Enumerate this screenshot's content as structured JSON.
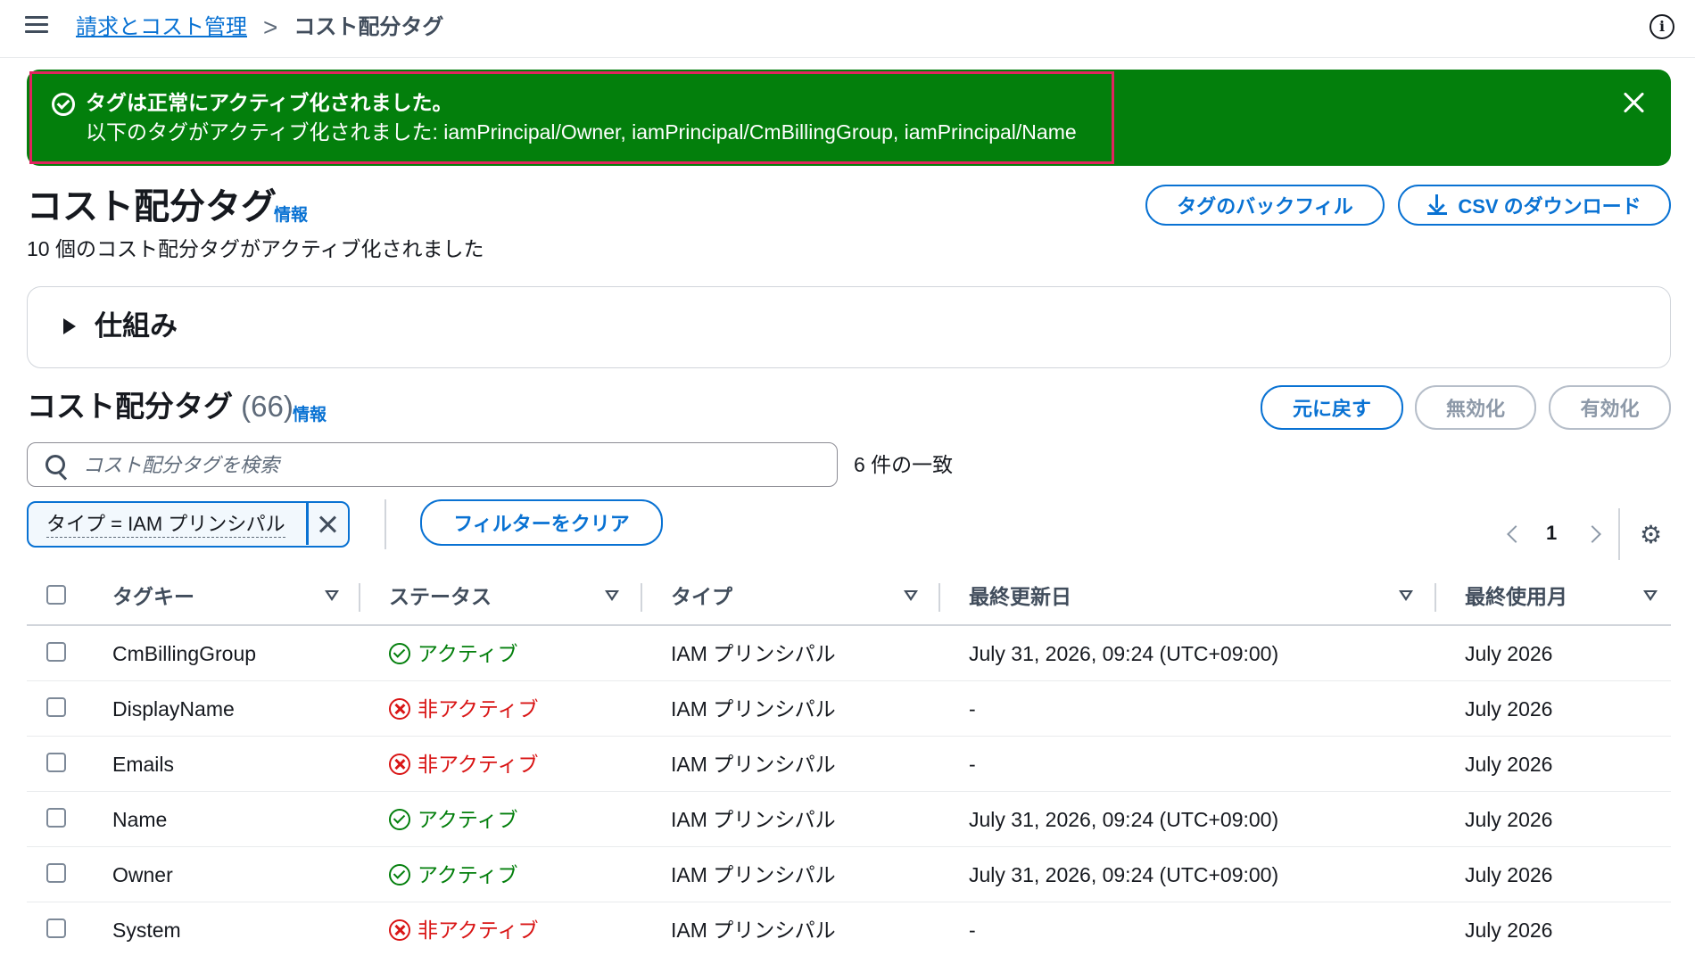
{
  "breadcrumb": {
    "parent": "請求とコスト管理",
    "separator": ">",
    "current": "コスト配分タグ"
  },
  "topbar": {
    "info_icon": "i"
  },
  "flash": {
    "type": "success",
    "title": "タグは正常にアクティブ化されました。",
    "message": "以下のタグがアクティブ化されました: iamPrincipal/Owner, iamPrincipal/CmBillingGroup, iamPrincipal/Name",
    "color": "#037f0c",
    "highlight_color": "#e0245e"
  },
  "header": {
    "title": "コスト配分タグ",
    "info_label": "情報",
    "subtitle": "10 個のコスト配分タグがアクティブ化されました",
    "backfill_label": "タグのバックフィル",
    "download_label": "CSV のダウンロード"
  },
  "how_it_works": {
    "label": "仕組み",
    "expanded": false
  },
  "table_section": {
    "title": "コスト配分タグ",
    "count": "(66)",
    "info_label": "情報",
    "revert_label": "元に戻す",
    "deactivate_label": "無効化",
    "activate_label": "有効化",
    "search_placeholder": "コスト配分タグを検索",
    "match_count": "6 件の一致",
    "filter_token": "タイプ = IAM プリンシパル",
    "clear_filter_label": "フィルターをクリア",
    "page": "1"
  },
  "columns": [
    "タグキー",
    "ステータス",
    "タイプ",
    "最終更新日",
    "最終使用月"
  ],
  "rows": [
    {
      "key": "CmBillingGroup",
      "status": "アクティブ",
      "status_kind": "active",
      "type": "IAM プリンシパル",
      "updated": "July 31, 2026, 09:24 (UTC+09:00)",
      "last_used": "July 2026"
    },
    {
      "key": "DisplayName",
      "status": "非アクティブ",
      "status_kind": "inactive",
      "type": "IAM プリンシパル",
      "updated": "-",
      "last_used": "July 2026"
    },
    {
      "key": "Emails",
      "status": "非アクティブ",
      "status_kind": "inactive",
      "type": "IAM プリンシパル",
      "updated": "-",
      "last_used": "July 2026"
    },
    {
      "key": "Name",
      "status": "アクティブ",
      "status_kind": "active",
      "type": "IAM プリンシパル",
      "updated": "July 31, 2026, 09:24 (UTC+09:00)",
      "last_used": "July 2026"
    },
    {
      "key": "Owner",
      "status": "アクティブ",
      "status_kind": "active",
      "type": "IAM プリンシパル",
      "updated": "July 31, 2026, 09:24 (UTC+09:00)",
      "last_used": "July 2026"
    },
    {
      "key": "System",
      "status": "非アクティブ",
      "status_kind": "inactive",
      "type": "IAM プリンシパル",
      "updated": "-",
      "last_used": "July 2026"
    }
  ],
  "colors": {
    "link": "#0972d3",
    "active": "#037f0c",
    "inactive": "#d91515",
    "disabled": "#8d99a8"
  }
}
